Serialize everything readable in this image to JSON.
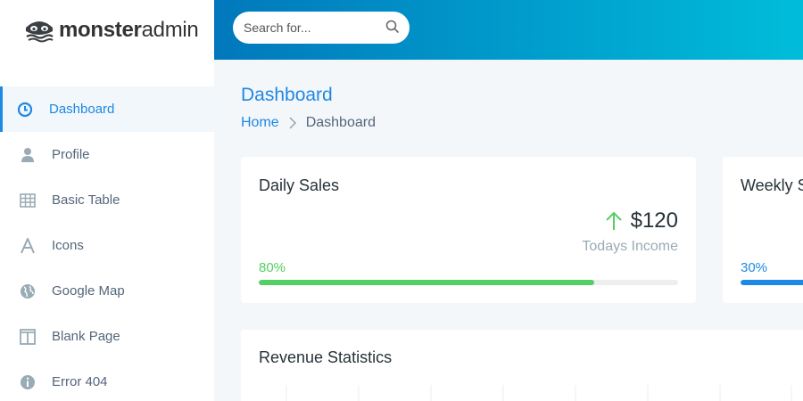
{
  "brand": {
    "strong": "monster",
    "light": "admin"
  },
  "search": {
    "placeholder": "Search for..."
  },
  "sidebar": {
    "items": [
      {
        "label": "Dashboard",
        "icon": "clock-icon",
        "active": true
      },
      {
        "label": "Profile",
        "icon": "user-icon",
        "active": false
      },
      {
        "label": "Basic Table",
        "icon": "table-icon",
        "active": false
      },
      {
        "label": "Icons",
        "icon": "font-icon",
        "active": false
      },
      {
        "label": "Google Map",
        "icon": "globe-icon",
        "active": false
      },
      {
        "label": "Blank Page",
        "icon": "columns-icon",
        "active": false
      },
      {
        "label": "Error 404",
        "icon": "info-icon",
        "active": false
      }
    ]
  },
  "page": {
    "title": "Dashboard",
    "breadcrumb": {
      "home": "Home",
      "current": "Dashboard"
    }
  },
  "cards": {
    "daily": {
      "title": "Daily Sales",
      "amount": "$120",
      "amount_label": "Todays Income",
      "percent_label": "80%",
      "progress": 0.8,
      "color": "#55ce63"
    },
    "weekly": {
      "title": "Weekly S",
      "percent_label": "30%",
      "color": "#1e88e5"
    },
    "revenue": {
      "title": "Revenue Statistics"
    }
  },
  "colors": {
    "accent": "#1e88e5",
    "success": "#55ce63",
    "topbar_start": "#0178bc",
    "topbar_end": "#00bdda"
  }
}
